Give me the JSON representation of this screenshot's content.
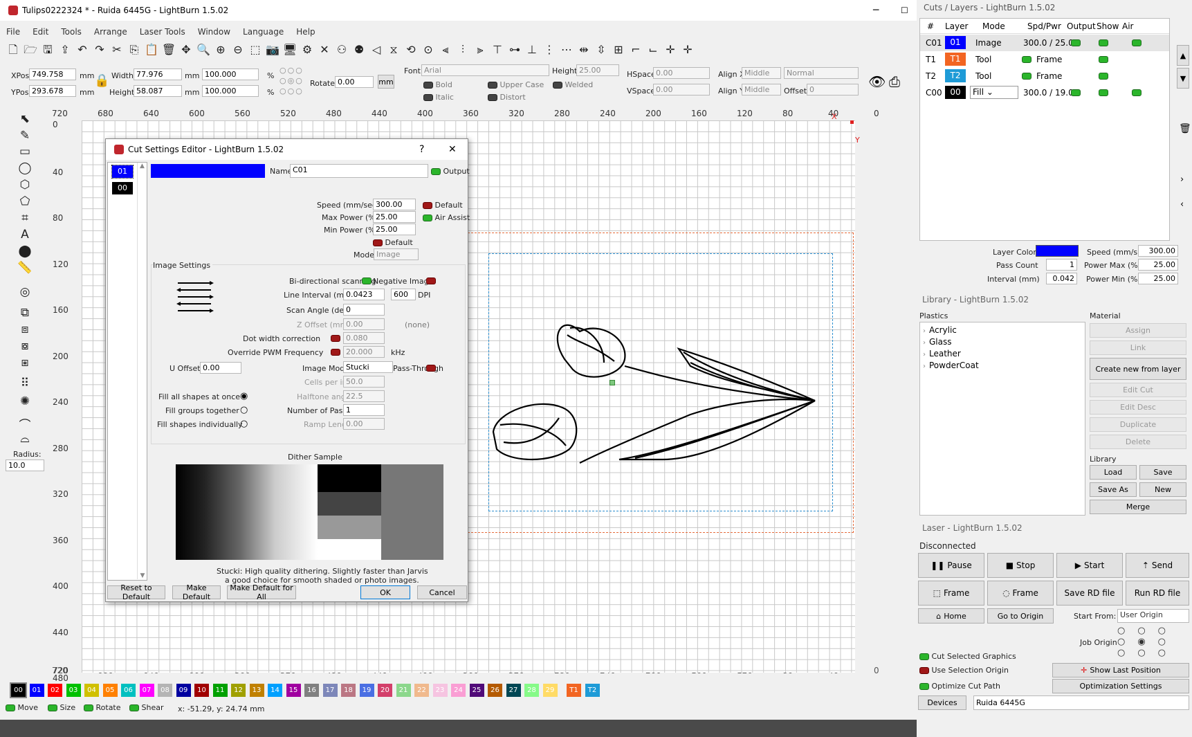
{
  "app": {
    "title": "Tulips0222324 * - Ruida 6445G - LightBurn 1.5.02"
  },
  "menu": [
    "File",
    "Edit",
    "Tools",
    "Arrange",
    "Laser Tools",
    "Window",
    "Language",
    "Help"
  ],
  "props": {
    "xpos_label": "XPos",
    "xpos": "749.758",
    "ypos_label": "YPos",
    "ypos": "293.678",
    "unit_mm": "mm",
    "width_label": "Width",
    "width": "77.976",
    "height_label": "Height",
    "height": "58.087",
    "wpct": "100.000",
    "hpct": "100.000",
    "pct": "%",
    "rotate_label": "Rotate",
    "rotate": "0.00",
    "mm_btn": "mm",
    "font_label": "Font",
    "font": "Arial",
    "fheight_label": "Height",
    "fheight": "25.00",
    "hspace_label": "HSpace",
    "hspace": "0.00",
    "vspace_label": "VSpace",
    "vspace": "0.00",
    "alignx_label": "Align X",
    "alignx": "Middle",
    "aligny_label": "Align Y",
    "aligny": "Middle",
    "normal": "Normal",
    "offset_label": "Offset",
    "offset": "0",
    "bold": "Bold",
    "italic": "Italic",
    "upper": "Upper Case",
    "distort": "Distort",
    "welded": "Welded"
  },
  "ruler": {
    "top": [
      "720",
      "680",
      "640",
      "600",
      "560",
      "520",
      "480",
      "440",
      "400",
      "360",
      "320",
      "280",
      "240",
      "200",
      "160",
      "120",
      "80",
      "40",
      "0",
      "-40"
    ],
    "left": [
      "0",
      "40",
      "80",
      "120",
      "160",
      "200",
      "240",
      "280",
      "320",
      "360",
      "400",
      "440",
      "480",
      "720"
    ],
    "bottom": [
      "720",
      "680",
      "640",
      "600",
      "560",
      "520",
      "480",
      "440",
      "400",
      "360",
      "320",
      "280",
      "240",
      "200",
      "160",
      "120",
      "80",
      "40",
      "0",
      "-40"
    ],
    "x_mark": "X",
    "y_mark": "Y"
  },
  "sidebar": {
    "radius_label": "Radius:",
    "radius": "10.0"
  },
  "palette": [
    {
      "label": "00",
      "color": "#000000"
    },
    {
      "label": "01",
      "color": "#0000ff"
    },
    {
      "label": "02",
      "color": "#ff0000"
    },
    {
      "label": "03",
      "color": "#00c000"
    },
    {
      "label": "04",
      "color": "#d0c000"
    },
    {
      "label": "05",
      "color": "#ff8000"
    },
    {
      "label": "06",
      "color": "#00c0c0"
    },
    {
      "label": "07",
      "color": "#ff00ff"
    },
    {
      "label": "08",
      "color": "#b4b4b4"
    },
    {
      "label": "09",
      "color": "#0000a0"
    },
    {
      "label": "10",
      "color": "#a00000"
    },
    {
      "label": "11",
      "color": "#00a000"
    },
    {
      "label": "12",
      "color": "#a0a000"
    },
    {
      "label": "13",
      "color": "#c08000"
    },
    {
      "label": "14",
      "color": "#00a0ff"
    },
    {
      "label": "15",
      "color": "#a000a0"
    },
    {
      "label": "16",
      "color": "#808080"
    },
    {
      "label": "17",
      "color": "#7d87b9"
    },
    {
      "label": "18",
      "color": "#bb7784"
    },
    {
      "label": "19",
      "color": "#4a6fe3"
    },
    {
      "label": "20",
      "color": "#d33f6a"
    },
    {
      "label": "21",
      "color": "#8cd78c"
    },
    {
      "label": "22",
      "color": "#f0b98d"
    },
    {
      "label": "23",
      "color": "#f6c4e1"
    },
    {
      "label": "24",
      "color": "#fa9ed4"
    },
    {
      "label": "25",
      "color": "#500a78"
    },
    {
      "label": "26",
      "color": "#b45a00"
    },
    {
      "label": "27",
      "color": "#004754"
    },
    {
      "label": "28",
      "color": "#86fa88"
    },
    {
      "label": "29",
      "color": "#ffdb66"
    },
    {
      "label": "T1",
      "color": "#f26522"
    },
    {
      "label": "T2",
      "color": "#1e9bd7"
    }
  ],
  "statusbar": {
    "move": "Move",
    "size": "Size",
    "rotate": "Rotate",
    "shear": "Shear",
    "coords": "x: -51.29, y: 24.74 mm"
  },
  "dialog": {
    "title": "Cut Settings Editor - LightBurn 1.5.02",
    "help": "?",
    "close": "✕",
    "layer_sel": "01",
    "layer_other": "00",
    "layer_color": "#0000ff",
    "name_label": "Name",
    "name": "C01",
    "output": "Output",
    "speed_label": "Speed (mm/sec)",
    "speed": "300.00",
    "default1": "Default",
    "maxp_label": "Max Power (%)",
    "maxp": "25.00",
    "air": "Air Assist",
    "minp_label": "Min Power (%)",
    "minp": "25.00",
    "default2": "Default",
    "mode_label": "Mode",
    "mode": "Image",
    "image_settings": "Image Settings",
    "bidir": "Bi-directional scanning",
    "neg": "Negative Image",
    "interval_label": "Line Interval (mm)",
    "interval": "0.0423",
    "dpi_val": "600",
    "dpi": "DPI",
    "scan_label": "Scan Angle (deg)",
    "scan": "0",
    "zoff_label": "Z Offset (mm)",
    "zoff": "0.00",
    "none": "(none)",
    "dotw_label": "Dot width correction",
    "dotw": "0.080",
    "pwm_label": "Override PWM Frequency",
    "pwm": "20.000",
    "khz": "kHz",
    "uoff_label": "U Offset",
    "uoff": "0.00",
    "imgmode_label": "Image Mode",
    "imgmode": "Stucki",
    "pass": "Pass-Through",
    "cpi_label": "Cells per inch",
    "cpi": "50.0",
    "half_label": "Halftone angle",
    "half": "22.5",
    "passes_label": "Number of Passes",
    "passes": "1",
    "ramp_label": "Ramp Length",
    "ramp": "0.00",
    "fill_all": "Fill all shapes at once",
    "fill_groups": "Fill groups together",
    "fill_ind": "Fill shapes individually",
    "dither": "Dither Sample",
    "desc1": "Stucki: High quality dithering. Slightly faster than Jarvis",
    "desc2": "a good choice for smooth shaded or photo images.",
    "reset": "Reset to Default",
    "make_default": "Make Default",
    "make_all": "Make Default for All",
    "ok": "OK",
    "cancel": "Cancel"
  },
  "cuts": {
    "title": "Cuts / Layers - LightBurn 1.5.02",
    "headers": [
      "#",
      "Layer",
      "Mode",
      "Spd/Pwr",
      "Output",
      "Show",
      "Air"
    ],
    "rows": [
      {
        "id": "C01",
        "layer": "01",
        "color": "#0000ff",
        "mode": "Image",
        "spd": "300.0 / 25.0"
      },
      {
        "id": "T1",
        "layer": "T1",
        "color": "#f26522",
        "mode": "Tool",
        "spd": "Frame"
      },
      {
        "id": "T2",
        "layer": "T2",
        "color": "#1e9bd7",
        "mode": "Tool",
        "spd": "Frame"
      },
      {
        "id": "C00",
        "layer": "00",
        "color": "#000000",
        "mode": "Fill",
        "spd": "300.0 / 19.0"
      }
    ],
    "layer_color_label": "Layer Color",
    "pass_label": "Pass Count",
    "pass": "1",
    "interval_label": "Interval (mm)",
    "interval": "0.042",
    "speed_label": "Speed (mm/s)",
    "speed": "300.00",
    "pmax_label": "Power Max (%)",
    "pmax": "25.00",
    "pmin_label": "Power Min (%)",
    "pmin": "25.00"
  },
  "library": {
    "title": "Library - LightBurn 1.5.02",
    "group": "Plastics",
    "items": [
      "Acrylic",
      "Glass",
      "Leather",
      "PowderCoat"
    ],
    "material": "Material",
    "assign": "Assign",
    "link": "Link",
    "create": "Create new from layer",
    "edit_cut": "Edit Cut",
    "edit_desc": "Edit Desc",
    "duplicate": "Duplicate",
    "delete": "Delete",
    "library": "Library",
    "load": "Load",
    "save": "Save",
    "save_as": "Save As",
    "new": "New",
    "merge": "Merge"
  },
  "laser": {
    "title": "Laser - LightBurn 1.5.02",
    "status": "Disconnected",
    "pause": "Pause",
    "stop": "Stop",
    "start": "Start",
    "send": "Send",
    "frame1": "Frame",
    "frame2": "Frame",
    "save_rd": "Save RD file",
    "run_rd": "Run RD file",
    "home": "Home",
    "origin": "Go to Origin",
    "start_from_label": "Start From:",
    "start_from": "User Origin",
    "job_origin": "Job Origin",
    "cut_sel": "Cut Selected Graphics",
    "use_sel": "Use Selection Origin",
    "opt_path": "Optimize Cut Path",
    "show_last": "Show Last Position",
    "opt_settings": "Optimization Settings",
    "devices": "Devices",
    "device": "Ruida 6445G"
  }
}
